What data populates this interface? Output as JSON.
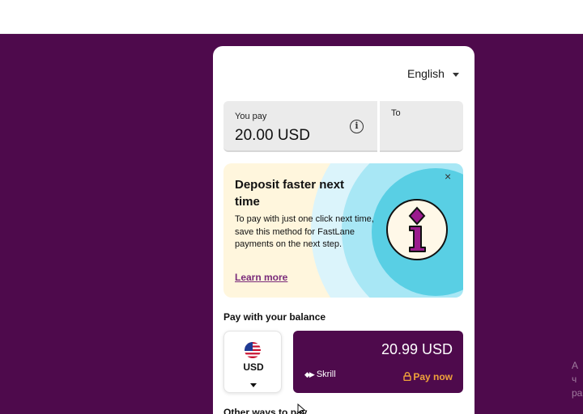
{
  "language": {
    "selected": "English"
  },
  "pay_field": {
    "label": "You pay",
    "value": "20.00 USD"
  },
  "to_field": {
    "label": "To"
  },
  "promo": {
    "title": "Deposit faster next time",
    "description": "To pay with just one click next time, save this method for FastLane payments on the next step.",
    "link": "Learn more",
    "close": "×"
  },
  "balance_section": {
    "title": "Pay with your balance",
    "currency": "USD",
    "amount": "20.99 USD",
    "wallet": "Skrill",
    "pay_button": "Pay now"
  },
  "other_ways": "Other ways to pay",
  "colors": {
    "brand": "#4e0a4c",
    "accent": "#f0a33a",
    "link": "#7a2b7a"
  }
}
